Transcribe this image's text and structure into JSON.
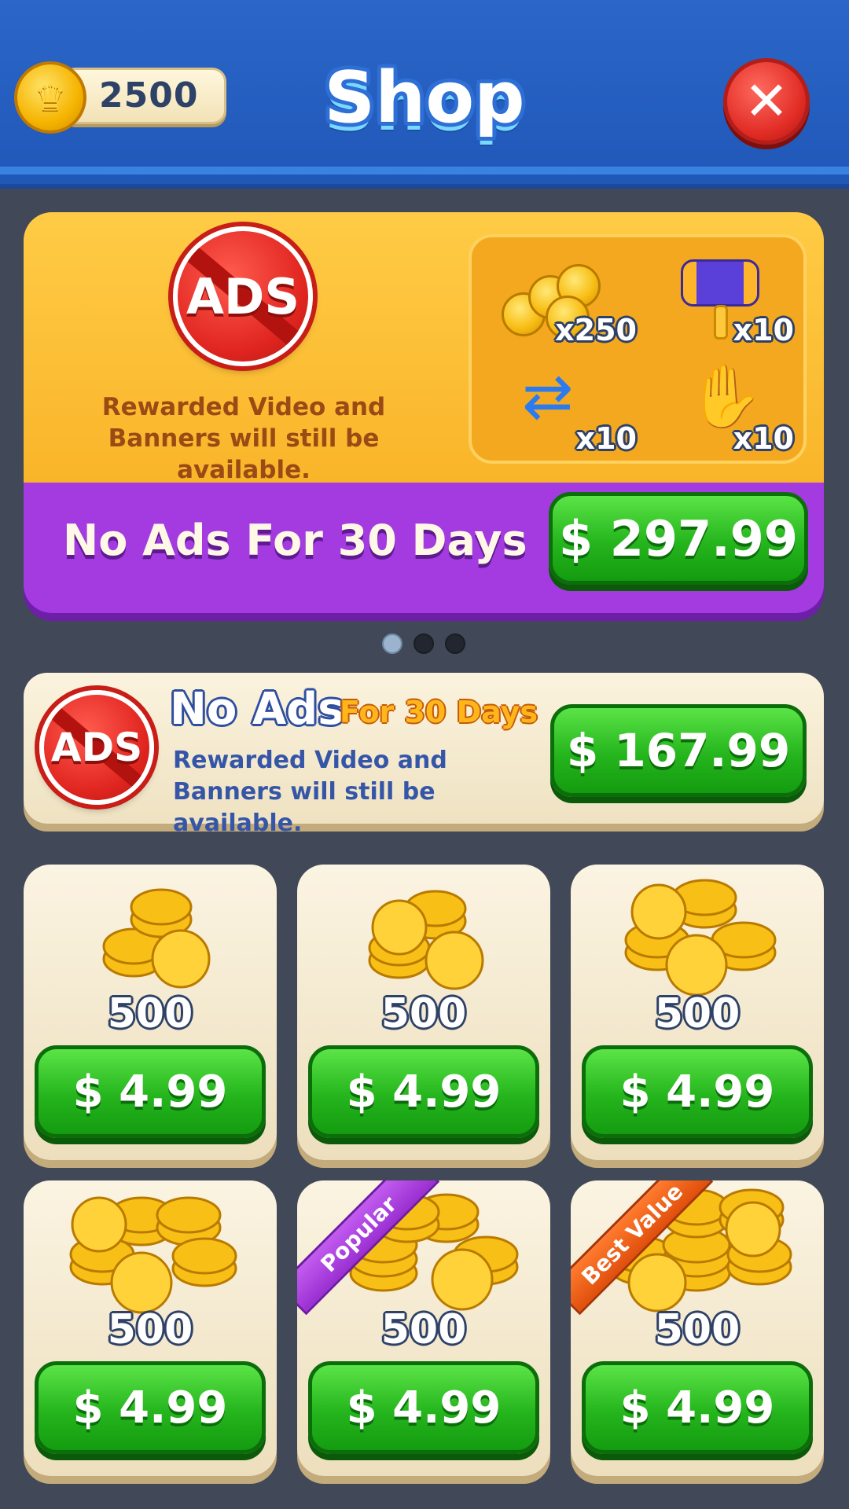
{
  "header": {
    "coin_balance": "2500",
    "title": "Shop",
    "close_symbol": "✕",
    "coin_icon": "crown-coin-icon"
  },
  "banner": {
    "badge_text": "ADS",
    "note": "Rewarded Video and Banners will still be available.",
    "rewards": [
      {
        "icon": "coin-stack-icon",
        "qty": "x250"
      },
      {
        "icon": "hammer-icon",
        "qty": "x10"
      },
      {
        "icon": "shuffle-arrows-icon",
        "qty": "x10"
      },
      {
        "icon": "glove-icon",
        "qty": "x10"
      }
    ],
    "label": "No Ads For 30 Days",
    "price": "$ 297.99"
  },
  "pager": {
    "count": 3,
    "active": 1
  },
  "no_ads": {
    "badge_text": "ADS",
    "title": "No Ads",
    "subtitle": "For 30 Days",
    "note": "Rewarded Video and Banners will still be available.",
    "price": "$ 167.99"
  },
  "packs": [
    {
      "amount": "500",
      "price": "$ 4.99",
      "ribbon": ""
    },
    {
      "amount": "500",
      "price": "$ 4.99",
      "ribbon": ""
    },
    {
      "amount": "500",
      "price": "$ 4.99",
      "ribbon": ""
    },
    {
      "amount": "500",
      "price": "$ 4.99",
      "ribbon": ""
    },
    {
      "amount": "500",
      "price": "$ 4.99",
      "ribbon": "Popular"
    },
    {
      "amount": "500",
      "price": "$ 4.99",
      "ribbon": "Best Value"
    }
  ],
  "colors": {
    "background": "#414857",
    "header": "#2b66c8",
    "banner_top": "#ffcb45",
    "banner_bottom": "#a33be0",
    "buy_button": "#25b51d",
    "card": "#fbf4e2"
  }
}
